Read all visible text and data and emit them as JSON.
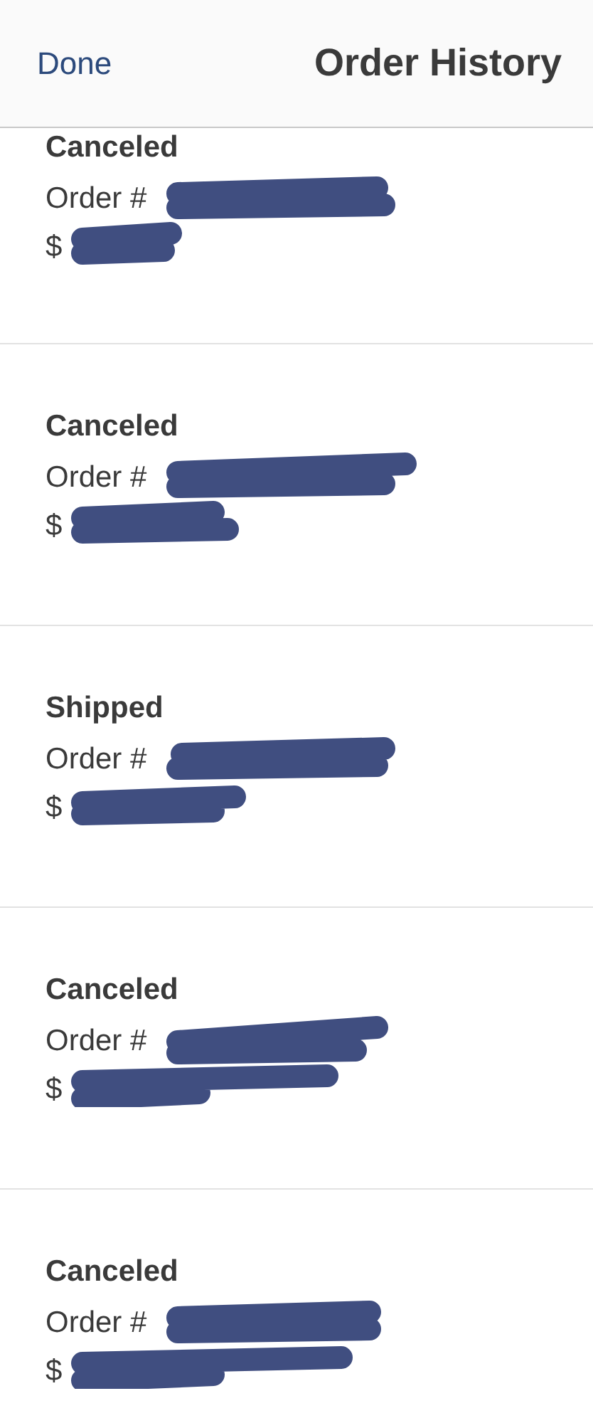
{
  "header": {
    "done": "Done",
    "title": "Order History"
  },
  "orders": [
    {
      "status": "Canceled",
      "order_label": "Order #",
      "price": "$"
    },
    {
      "status": "Canceled",
      "order_label": "Order #",
      "price": "$"
    },
    {
      "status": "Shipped",
      "order_label": "Order #",
      "price": "$"
    },
    {
      "status": "Canceled",
      "order_label": "Order #",
      "price": "$"
    },
    {
      "status": "Canceled",
      "order_label": "Order #",
      "price": "$"
    }
  ]
}
